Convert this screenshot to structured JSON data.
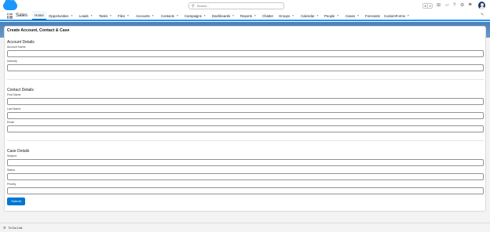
{
  "header": {
    "search_placeholder": "Search...",
    "favorites_star": "★",
    "favorites_chevron": "▾",
    "icons": [
      "add-icon",
      "trailhead-icon",
      "help-icon",
      "settings-icon",
      "notifications-icon"
    ]
  },
  "nav": {
    "app_name": "Sales",
    "items": [
      {
        "label": "Home"
      },
      {
        "label": "Opportunities"
      },
      {
        "label": "Leads"
      },
      {
        "label": "Tasks"
      },
      {
        "label": "Files"
      },
      {
        "label": "Accounts"
      },
      {
        "label": "Contacts"
      },
      {
        "label": "Campaigns"
      },
      {
        "label": "Dashboards"
      },
      {
        "label": "Reports"
      },
      {
        "label": "Chatter"
      },
      {
        "label": "Groups"
      },
      {
        "label": "Calendar"
      },
      {
        "label": "People"
      },
      {
        "label": "Cases"
      },
      {
        "label": "Forecasts"
      },
      {
        "label": "CustomForms"
      }
    ],
    "active": "Home",
    "chevron": "▾"
  },
  "form": {
    "title": "Create Account, Contact & Case",
    "sections": [
      {
        "title": "Account Details",
        "fields": [
          {
            "label": "Account Name",
            "value": ""
          },
          {
            "label": "Industry",
            "value": ""
          }
        ]
      },
      {
        "title": "Contact Details",
        "fields": [
          {
            "label": "First Name",
            "value": ""
          },
          {
            "label": "Last Name",
            "value": ""
          },
          {
            "label": "Email",
            "value": ""
          }
        ]
      },
      {
        "title": "Case Details",
        "fields": [
          {
            "label": "Subject",
            "value": ""
          },
          {
            "label": "Status",
            "value": ""
          },
          {
            "label": "Priority",
            "value": ""
          }
        ]
      }
    ],
    "submit_label": "Submit"
  },
  "footer": {
    "label": "To Do List"
  },
  "colors": {
    "brand": "#0176d3",
    "nav_accent": "#1b96ff",
    "band": "#5a8bc0"
  }
}
